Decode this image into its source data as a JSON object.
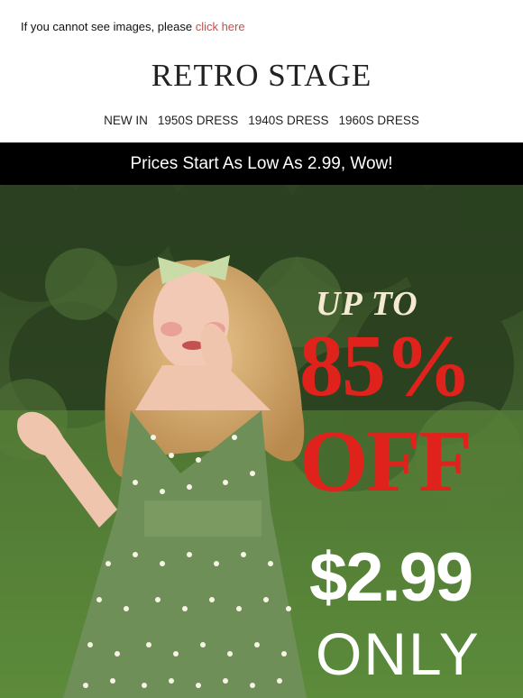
{
  "preheader": {
    "text": "If you cannot see images, please",
    "link": "click here"
  },
  "logo": "RETRO STAGE",
  "nav": [
    "NEW IN",
    "1950S DRESS",
    "1940S DRESS",
    "1960S DRESS"
  ],
  "promo_bar": "Prices Start As Low As 2.99, Wow!",
  "hero": {
    "up_to": "UP TO",
    "percent": "85%",
    "off": "OFF",
    "price": "$2.99",
    "only": "ONLY"
  },
  "colors": {
    "accent_red": "#e0221c",
    "link": "#c0504d",
    "bar": "#000000"
  }
}
